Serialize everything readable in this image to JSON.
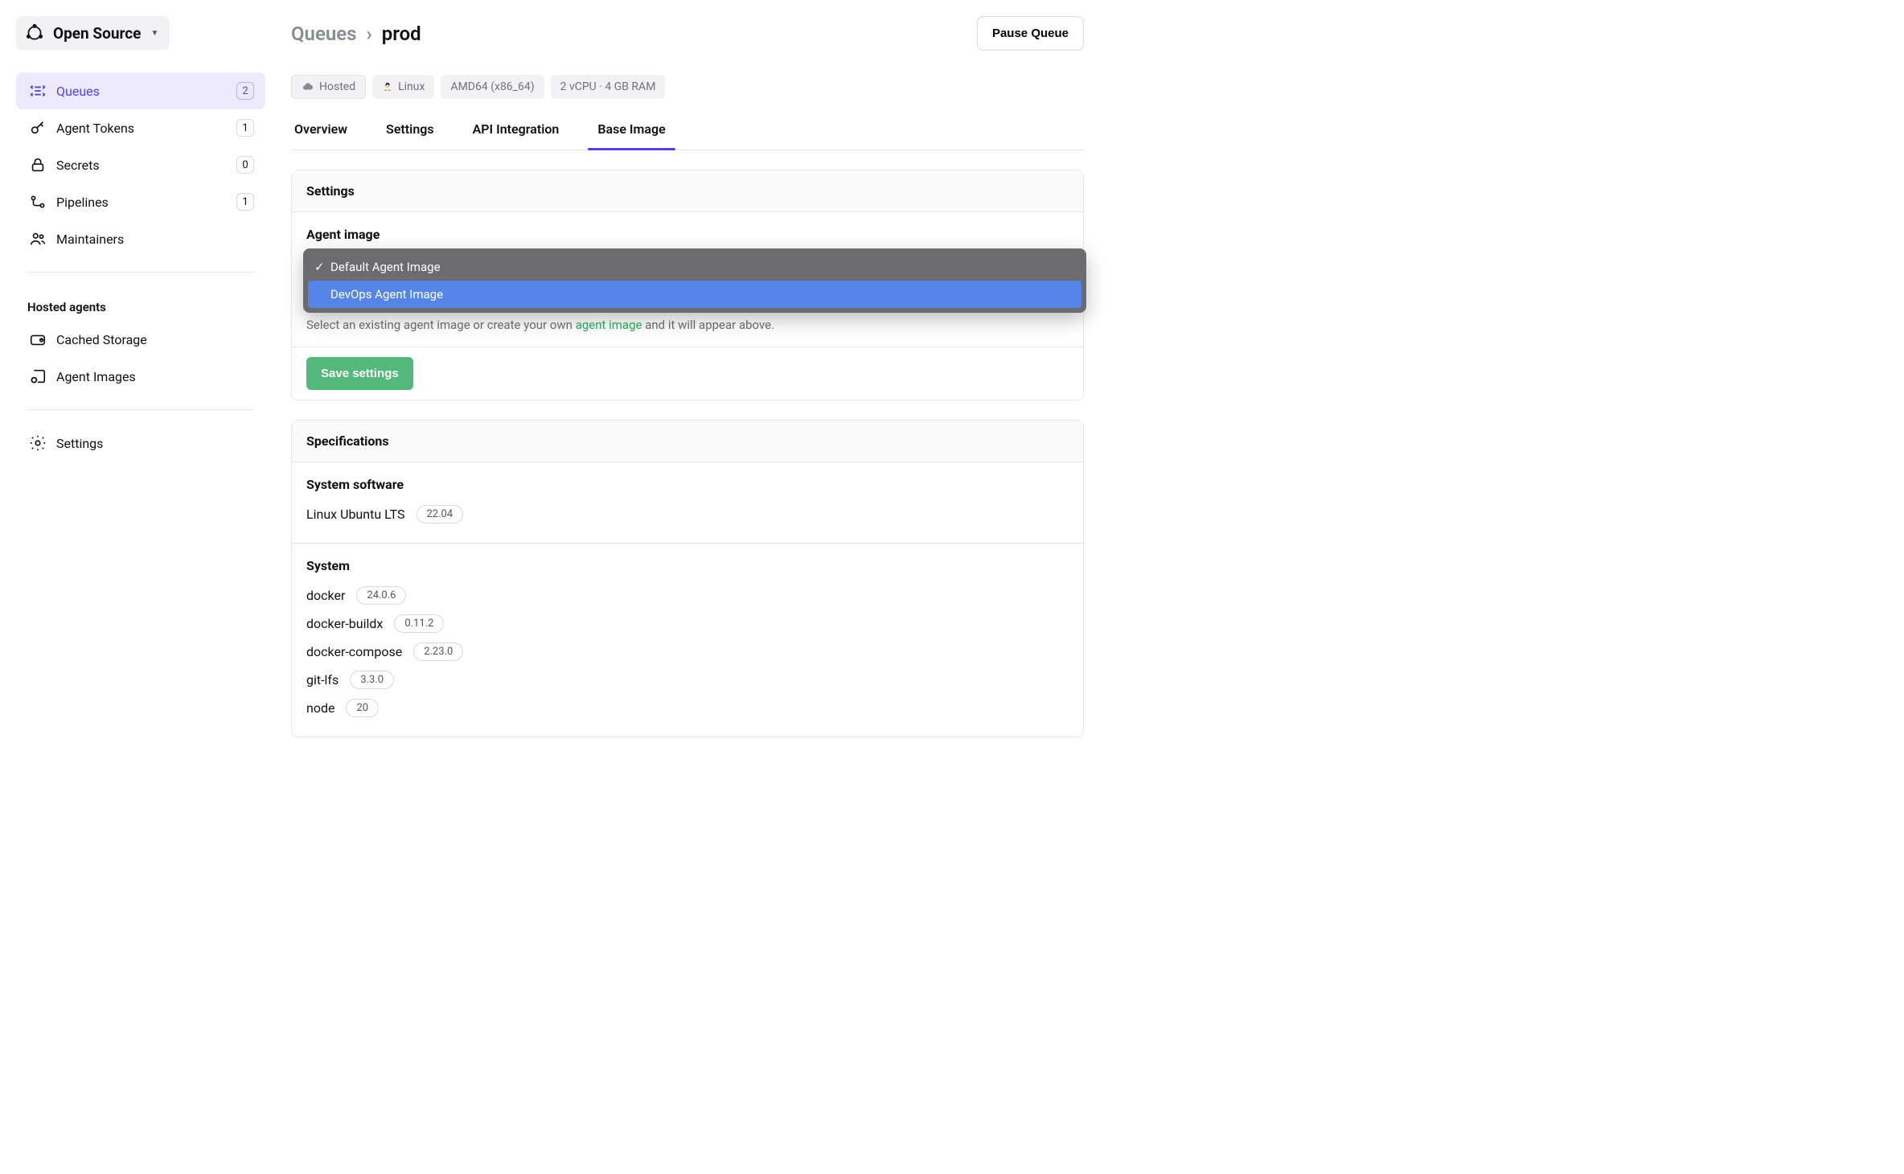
{
  "org": {
    "name": "Open Source"
  },
  "sidebar": {
    "items": [
      {
        "label": "Queues",
        "badge": "2",
        "active": true,
        "icon": "queues"
      },
      {
        "label": "Agent Tokens",
        "badge": "1",
        "icon": "key"
      },
      {
        "label": "Secrets",
        "badge": "0",
        "icon": "lock"
      },
      {
        "label": "Pipelines",
        "badge": "1",
        "icon": "pipelines"
      },
      {
        "label": "Maintainers",
        "badge": null,
        "icon": "people"
      }
    ],
    "hosted_title": "Hosted agents",
    "hosted_items": [
      {
        "label": "Cached Storage",
        "icon": "storage"
      },
      {
        "label": "Agent Images",
        "icon": "image-gear"
      }
    ],
    "settings_label": "Settings"
  },
  "breadcrumb": {
    "root": "Queues",
    "current": "prod"
  },
  "header_button": "Pause Queue",
  "chips": {
    "hosted": "Hosted",
    "os": "Linux",
    "arch": "AMD64 (x86_64)",
    "resources": "2 vCPU · 4 GB RAM"
  },
  "tabs": [
    {
      "label": "Overview"
    },
    {
      "label": "Settings"
    },
    {
      "label": "API Integration"
    },
    {
      "label": "Base Image",
      "active": true
    }
  ],
  "settings_panel": {
    "title": "Settings",
    "field_label": "Agent image",
    "dropdown": {
      "options": [
        {
          "label": "Default Agent Image",
          "checked": true
        },
        {
          "label": "DevOps Agent Image",
          "hover": true
        }
      ]
    },
    "helper_pre": "Select an existing agent image or create your own ",
    "helper_link": "agent image",
    "helper_post": " and it will appear above.",
    "save_label": "Save settings"
  },
  "spec_panel": {
    "title": "Specifications",
    "system_software": {
      "heading": "System software",
      "name": "Linux Ubuntu LTS",
      "version": "22.04"
    },
    "system": {
      "heading": "System",
      "rows": [
        {
          "name": "docker",
          "version": "24.0.6"
        },
        {
          "name": "docker-buildx",
          "version": "0.11.2"
        },
        {
          "name": "docker-compose",
          "version": "2.23.0"
        },
        {
          "name": "git-lfs",
          "version": "3.3.0"
        },
        {
          "name": "node",
          "version": "20"
        }
      ]
    }
  }
}
